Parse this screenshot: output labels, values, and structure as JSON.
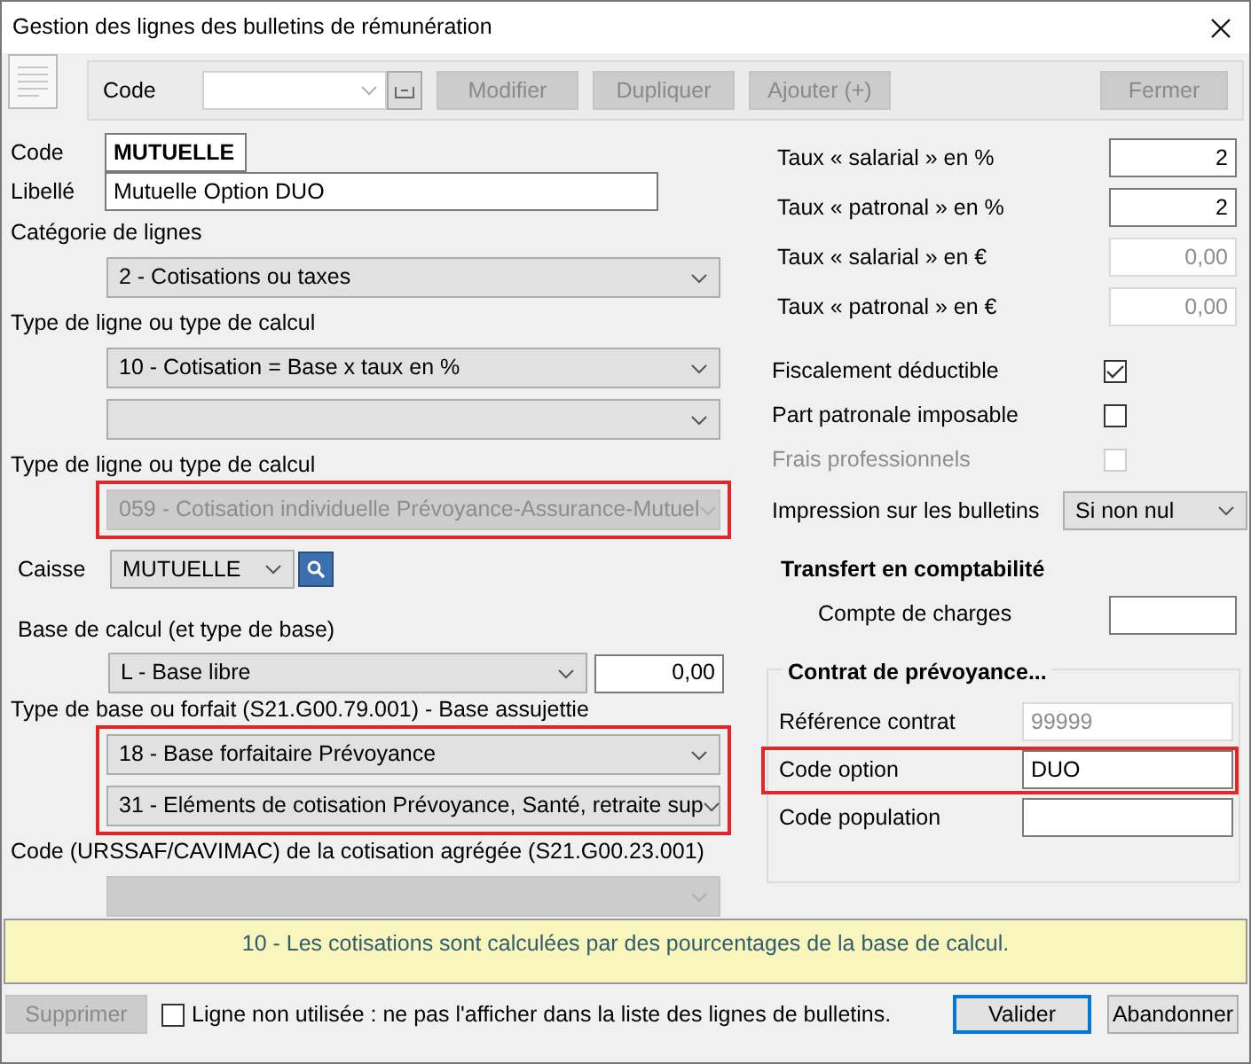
{
  "window": {
    "title": "Gestion des lignes des bulletins de rémunération"
  },
  "toolbar": {
    "code_label": "Code",
    "buttons": [
      {
        "label": "Modifier",
        "disabled": true
      },
      {
        "label": "Dupliquer",
        "disabled": true
      },
      {
        "label": "Ajouter (+)",
        "disabled": true
      }
    ],
    "close_button": {
      "label": "Fermer",
      "disabled": true
    }
  },
  "identity": {
    "code": {
      "label": "Code",
      "value": "MUTUELLE"
    },
    "libelle": {
      "label": "Libellé",
      "value": "Mutuelle Option DUO"
    }
  },
  "left_groups": [
    {
      "kind": "selects",
      "label": "Catégorie de lignes",
      "highlighted": false,
      "selects": [
        {
          "value": "2 - Cotisations ou taxes",
          "disabled": false
        }
      ]
    },
    {
      "kind": "selects",
      "label": "Type de ligne ou type de calcul",
      "highlighted": false,
      "selects": [
        {
          "value": "10 - Cotisation = Base x taux en %",
          "disabled": false
        },
        {
          "disabled": false
        }
      ]
    },
    {
      "kind": "selects",
      "label": "Type de ligne ou type de calcul",
      "highlighted": true,
      "selects": [
        {
          "value": "059 - Cotisation individuelle Prévoyance-Assurance-Mutuel",
          "disabled": true
        }
      ]
    },
    {
      "kind": "caisse",
      "label": "Caisse",
      "value": "MUTUELLE"
    },
    {
      "kind": "base",
      "label": "Base de calcul (et type de base)",
      "value": "L - Base libre",
      "amount": "0,00"
    },
    {
      "kind": "selects",
      "label": "Type de base ou forfait (S21.G00.79.001) - Base assujettie",
      "highlighted": true,
      "selects": [
        {
          "value": "18 - Base forfaitaire Prévoyance",
          "disabled": false
        },
        {
          "value": "31 - Eléments de cotisation Prévoyance, Santé, retraite sup",
          "disabled": false
        }
      ]
    },
    {
      "kind": "selects",
      "label": "Code (URSSAF/CAVIMAC) de la cotisation agrégée (S21.G00.23.001)",
      "highlighted": false,
      "selects": [
        {
          "disabled": true
        }
      ]
    }
  ],
  "rates": [
    {
      "label": "Taux « salarial » en %",
      "value": "2",
      "disabled": false
    },
    {
      "label": "Taux « patronal » en %",
      "value": "2",
      "disabled": false
    },
    {
      "label": "Taux « salarial » en €",
      "value": "0,00",
      "disabled": true
    },
    {
      "label": "Taux « patronal » en €",
      "value": "0,00",
      "disabled": true
    }
  ],
  "checks": [
    {
      "label": "Fiscalement déductible",
      "checked": true,
      "disabled": false
    },
    {
      "label": "Part patronale imposable",
      "checked": false,
      "disabled": false
    },
    {
      "label": "Frais professionnels",
      "checked": false,
      "disabled": true
    }
  ],
  "impression": {
    "label": "Impression sur les bulletins",
    "value": "Si non nul"
  },
  "transfert": {
    "title": "Transfert en comptabilité",
    "label": "Compte de charges"
  },
  "contrat": {
    "title": "Contrat de prévoyance...",
    "fields": [
      {
        "label": "Référence contrat",
        "value": "99999",
        "disabled": true,
        "highlighted": false
      },
      {
        "label": "Code option",
        "value": "DUO",
        "disabled": false,
        "highlighted": true
      },
      {
        "label": "Code population",
        "disabled": false,
        "highlighted": false
      }
    ]
  },
  "info": "10 - Les cotisations sont calculées par des pourcentages de la base de calcul.",
  "footer": {
    "delete_button": {
      "label": "Supprimer",
      "disabled": true
    },
    "unused": {
      "label": "Ligne non utilisée : ne pas l'afficher dans la liste des lignes de bulletins.",
      "checked": false
    },
    "buttons": [
      {
        "label": "Valider",
        "default": true
      },
      {
        "label": "Abandonner",
        "default": false
      }
    ]
  }
}
